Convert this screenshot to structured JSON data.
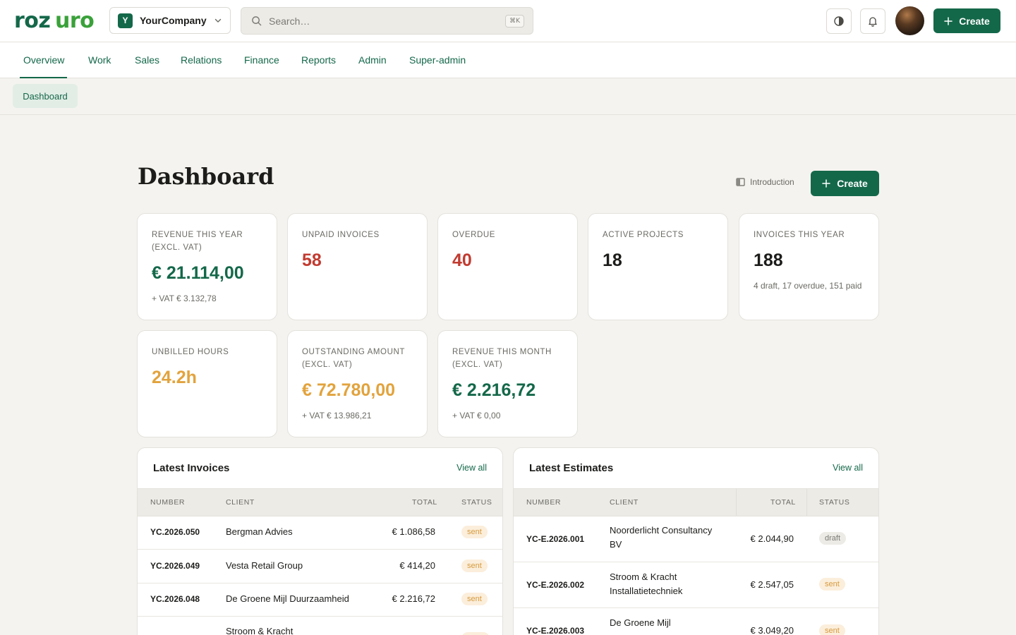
{
  "brand": {
    "logo_text": "rozuro",
    "accent": "#14684a",
    "logo_green": "#3aa13a"
  },
  "company": {
    "initial": "Y",
    "name": "YourCompany"
  },
  "search": {
    "placeholder": "Search…",
    "shortcut": "⌘K"
  },
  "header_actions": {
    "create_label": "Create"
  },
  "nav": {
    "tabs": [
      "Overview",
      "Work",
      "Sales",
      "Relations",
      "Finance",
      "Reports",
      "Admin",
      "Super-admin"
    ],
    "active": "Overview"
  },
  "subnav": {
    "active": "Dashboard"
  },
  "page": {
    "title": "Dashboard",
    "intro_label": "Introduction",
    "create_label": "Create"
  },
  "stats": [
    {
      "label": "Revenue this year (excl. VAT)",
      "value": "€ 21.114,00",
      "sub": "+ VAT € 3.132,78",
      "color": "green"
    },
    {
      "label": "Unpaid invoices",
      "value": "58",
      "sub": "",
      "color": "red"
    },
    {
      "label": "Overdue",
      "value": "40",
      "sub": "",
      "color": "red"
    },
    {
      "label": "Active projects",
      "value": "18",
      "sub": "",
      "color": "black"
    },
    {
      "label": "Invoices this year",
      "value": "188",
      "sub": "4 draft, 17 overdue, 151 paid",
      "color": "black"
    },
    {
      "label": "Unbilled hours",
      "value": "24.2h",
      "sub": "",
      "color": "orange"
    },
    {
      "label": "Outstanding amount (excl. VAT)",
      "value": "€ 72.780,00",
      "sub": "+ VAT € 13.986,21",
      "color": "orange"
    },
    {
      "label": "Revenue this month (excl. VAT)",
      "value": "€ 2.216,72",
      "sub": "+ VAT € 0,00",
      "color": "green"
    }
  ],
  "invoices": {
    "title": "Latest Invoices",
    "view_all": "View all",
    "columns": [
      "Number",
      "Client",
      "Total",
      "Status"
    ],
    "rows": [
      {
        "number": "YC.2026.050",
        "client": "Bergman Advies",
        "total": "€ 1.086,58",
        "status": "sent"
      },
      {
        "number": "YC.2026.049",
        "client": "Vesta Retail Group",
        "total": "€ 414,20",
        "status": "sent"
      },
      {
        "number": "YC.2026.048",
        "client": "De Groene Mijl Duurzaamheid",
        "total": "€ 2.216,72",
        "status": "sent"
      },
      {
        "number": "",
        "client": "Stroom & Kracht",
        "total": "",
        "status": ""
      }
    ]
  },
  "estimates": {
    "title": "Latest Estimates",
    "view_all": "View all",
    "columns": [
      "Number",
      "Client",
      "Total",
      "Status"
    ],
    "rows": [
      {
        "number": "YC-E.2026.001",
        "client_line1": "Noorderlicht Consultancy",
        "client_line2": "BV",
        "total": "€ 2.044,90",
        "status": "draft"
      },
      {
        "number": "YC-E.2026.002",
        "client_line1": "Stroom & Kracht",
        "client_line2": "Installatietechniek",
        "total": "€ 2.547,05",
        "status": "sent"
      },
      {
        "number": "YC-E.2026.003",
        "client_line1": "De Groene Mijl",
        "client_line2": "",
        "total": "€ 3.049,20",
        "status": "sent"
      }
    ]
  }
}
